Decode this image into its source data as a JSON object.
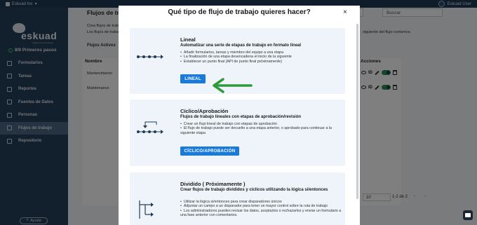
{
  "topbar": {
    "org": "Eskuad Inc",
    "user": "Eskuad User"
  },
  "sidebar": {
    "logo_word": "eskuad",
    "logo_tag": "Digital Field Workflows",
    "steps": "8/9 Primeros pasos",
    "items": [
      {
        "label": "Formularios",
        "icon": "form-icon"
      },
      {
        "label": "Tareas",
        "icon": "tasks-icon"
      },
      {
        "label": "Reportes",
        "icon": "reports-icon"
      },
      {
        "label": "Fuentes de Datos",
        "icon": "database-icon"
      },
      {
        "label": "Personas",
        "icon": "people-icon"
      },
      {
        "label": "Flujos de trabajo",
        "icon": "workflow-icon",
        "active": true
      },
      {
        "label": "Repositorio",
        "icon": "repository-icon"
      }
    ],
    "help": "Ayuda"
  },
  "page": {
    "title": "Flujos de trabajo",
    "desc1": "Crea flujos de trabajo",
    "desc2": "Los flujos de trabajo",
    "desc3": "siguiente del flujo comience.",
    "tab": "Flujos Activos",
    "search_placeholder": "Buscar",
    "col_name": "Nombre",
    "col_actions": "Acciones",
    "rows": [
      "Mantenimiento",
      "Maintenance"
    ],
    "row_id_label": "ID",
    "pager_size": "10",
    "pager_text": "1-2 de 2"
  },
  "modal": {
    "title": "Qué tipo de flujo de trabajo quieres hacer?",
    "close": "×",
    "cards": [
      {
        "name": "Lineal",
        "subtitle": "Automatizar una serie de etapas de trabajo en formato lineal",
        "bullets": [
          "Añadir formularios, tareas y miembro del equipo a una etapa",
          "La finalización de una etapa desencadena el inicio de la siguiente",
          "Establecer un punto final (API de punto final próximamente)"
        ],
        "button": "LINEAL"
      },
      {
        "name": "Cíclico/Aprobación",
        "subtitle": "Flujos de trabajo lineales con etapas de aprobación/revisión",
        "bullets": [
          "Crear un flujo lineal de trabajo con etapas de aprobación",
          "El flujo de trabajo puede ser devuelto a una etapa anterior, o aprobado para continuar a la siguiente etapa"
        ],
        "button": "CÍCLICO/APROBACIÓN"
      },
      {
        "name": "Dividido ( Próximamente )",
        "subtitle": "Crear flujos de trabajo divididos y cíclicos utilizando la lógica si/entonces",
        "bullets": [
          "Utilizar la lógica si/entonces para crear disparadores únicos",
          "Adjuntar un campo a un disparador para tener un mayor control sobre la ruta de trabajo",
          "Los administradores pueden revisar los datos, aceptarlos o rechazarlos y enviar un formulario a una fase anterior con comentarios."
        ]
      }
    ]
  },
  "colors": {
    "sidebar": "#243e5b",
    "primary_button": "#1a7ad9",
    "arrow": "#2f9a3c",
    "card_bg": "#eef4fa"
  }
}
